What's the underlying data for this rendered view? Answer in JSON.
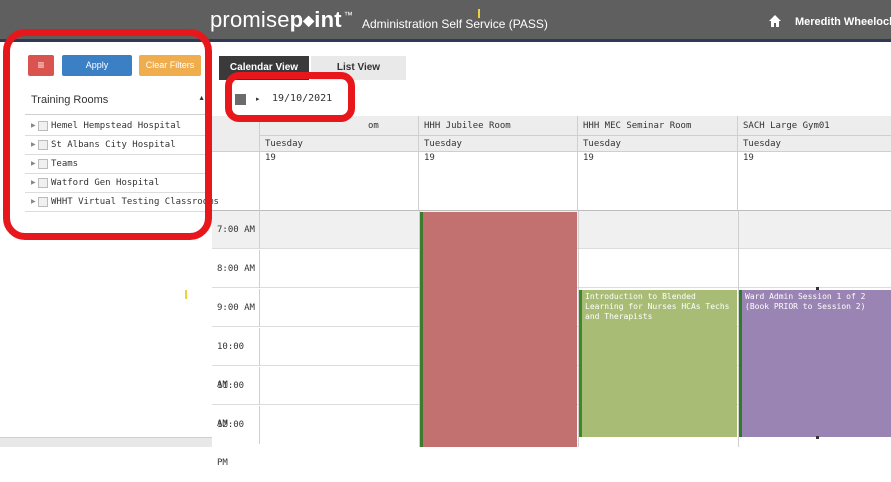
{
  "header": {
    "logo_left": "promise",
    "logo_mid": "p",
    "logo_dot": "◆",
    "logo_right": "int",
    "logo_tm": "™",
    "app_title": "Administration Self Service (PASS)",
    "user_name": "Meredith Wheelock",
    "home_icon": "home-icon"
  },
  "left_panel": {
    "menu_icon": "≡",
    "apply_label": "Apply",
    "clear_label": "Clear Filters",
    "rooms_title": "Training Rooms",
    "rooms_caret": "▲",
    "tree_items": [
      {
        "label": "Hemel Hempstead Hospital"
      },
      {
        "label": "St Albans City Hospital"
      },
      {
        "label": "Teams"
      },
      {
        "label": "Watford Gen Hospital"
      },
      {
        "label": "WHHT Virtual Testing Classrooms"
      }
    ]
  },
  "tabs": [
    {
      "label": "Calendar View",
      "active": true
    },
    {
      "label": "List View",
      "active": false
    }
  ],
  "date_bar": {
    "caret": "▸",
    "date": "19/10/2021"
  },
  "calendar": {
    "columns": [
      {
        "room": "om",
        "day": "Tuesday",
        "date": "19"
      },
      {
        "room": "HHH Jubilee Room",
        "day": "Tuesday",
        "date": "19"
      },
      {
        "room": "HHH MEC Seminar Room",
        "day": "Tuesday",
        "date": "19"
      },
      {
        "room": "SACH Large Gym01",
        "day": "Tuesday",
        "date": "19"
      }
    ],
    "times": [
      "7:00 AM",
      "8:00 AM",
      "9:00 AM",
      "10:00 AM",
      "11:00 AM",
      "12:00 PM"
    ],
    "events": [
      {
        "title": ""
      },
      {
        "title": "Introduction to Blended Learning for Nurses HCAs Techs and Therapists"
      },
      {
        "title": "Ward Admin Session 1 of 2 (Book PRIOR to Session 2)"
      }
    ]
  },
  "colors": {
    "header_bg": "#5f5f5f",
    "annotation_red": "#e8171b",
    "apply_blue": "#3b7fc4",
    "clear_orange": "#f0ad4e",
    "menu_red": "#d9534f",
    "event_red": "#c37070",
    "event_green": "#a8bc76",
    "event_purple": "#9a84b3"
  }
}
